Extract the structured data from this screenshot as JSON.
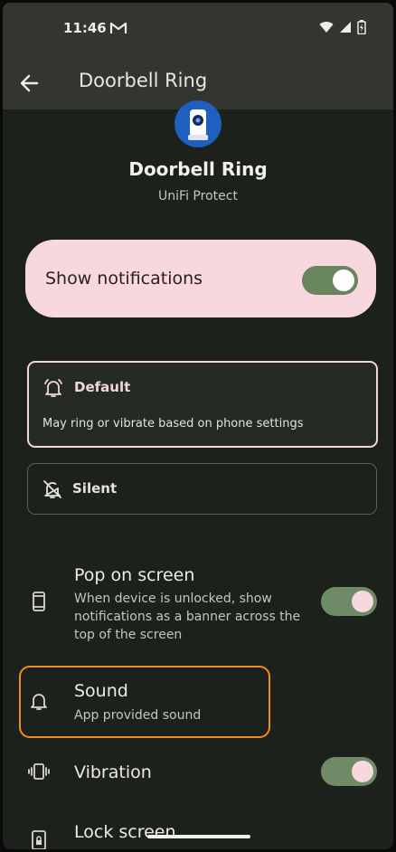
{
  "status_bar": {
    "time": "11:46",
    "icons": [
      "gmail-icon",
      "wifi-icon",
      "signal-icon",
      "battery-icon"
    ]
  },
  "app_bar": {
    "title": "Doorbell Ring",
    "back_icon": "arrow-left-icon"
  },
  "header": {
    "app_icon": "camera-icon",
    "channel_name": "Doorbell Ring",
    "app_name": "UniFi Protect"
  },
  "show_notifications": {
    "label": "Show notifications",
    "enabled": true
  },
  "options": {
    "default": {
      "label": "Default",
      "description": "May ring or vibrate based on phone settings",
      "icon": "bell-ringing-icon",
      "selected": true
    },
    "silent": {
      "label": "Silent",
      "icon": "bell-off-icon",
      "selected": false
    }
  },
  "settings": {
    "pop_on_screen": {
      "title": "Pop on screen",
      "description": "When device is unlocked, show notifications as a banner across the top of the screen",
      "icon": "phone-icon",
      "enabled": true
    },
    "sound": {
      "title": "Sound",
      "description": "App provided sound",
      "icon": "bell-icon"
    },
    "vibration": {
      "title": "Vibration",
      "icon": "vibration-icon",
      "enabled": true
    },
    "lock_screen": {
      "title": "Lock screen",
      "icon": "lock-phone-icon"
    }
  },
  "colors": {
    "background": "#1d211b",
    "surface": "#32362f",
    "accent_pink": "#f8d8de",
    "toggle_on": "#6e8a67",
    "highlight": "#ef8f19"
  }
}
